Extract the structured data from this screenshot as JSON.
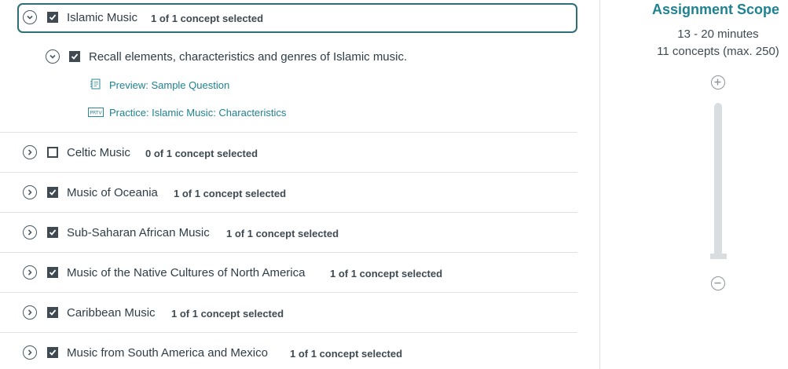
{
  "expanded_module": {
    "title": "Islamic Music",
    "count": "1 of 1 concept selected",
    "checked": true,
    "concept": {
      "label": "Recall elements, characteristics and genres of Islamic music.",
      "checked": true,
      "links": [
        {
          "icon": "sample-question-icon",
          "label": "Preview: Sample Question"
        },
        {
          "icon": "practice-icon",
          "icon_text": "PRTV",
          "label": "Practice: Islamic Music: Characteristics"
        }
      ]
    }
  },
  "modules": [
    {
      "title": "Celtic Music",
      "count": "0 of 1 concept selected",
      "checked": false
    },
    {
      "title": "Music of Oceania",
      "count": "1 of 1 concept selected",
      "checked": true
    },
    {
      "title": "Sub-Saharan African Music",
      "count": "1 of 1 concept selected",
      "checked": true
    },
    {
      "title": "Music of the Native Cultures of North America",
      "count": "1 of 1 concept selected",
      "checked": true
    },
    {
      "title": "Caribbean Music",
      "count": "1 of 1 concept selected",
      "checked": true
    },
    {
      "title": "Music from South America and Mexico",
      "count": "1 of 1 concept selected",
      "checked": true
    }
  ],
  "scope": {
    "title": "Assignment Scope",
    "time": "13 - 20 minutes",
    "concepts": "11 concepts (max. 250)",
    "slider_level": 0.0
  },
  "colors": {
    "accent": "#1f8290",
    "border_active": "#2e6f77",
    "checkbox": "#3f4a52"
  }
}
